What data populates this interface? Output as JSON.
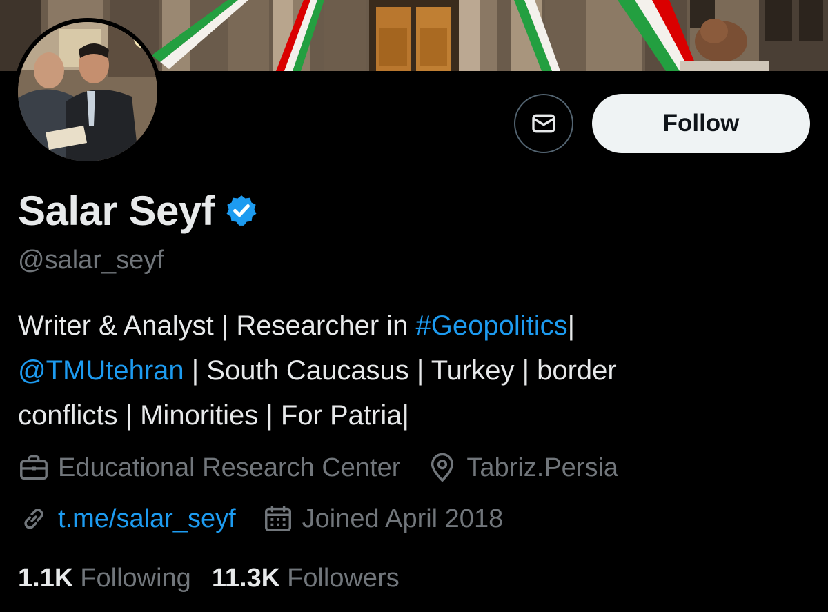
{
  "profile": {
    "display_name": "Salar Seyf",
    "verified": true,
    "handle": "@salar_seyf"
  },
  "actions": {
    "follow_label": "Follow",
    "message_icon": "envelope-icon"
  },
  "bio": {
    "line1": {
      "text": "Writer & Analyst | Researcher in ",
      "hashtag": "#Geopolitics",
      "tail": "|"
    },
    "line2": {
      "mention": "@TMUtehran",
      "text": " | South Caucasus | Turkey | border"
    },
    "line3": {
      "text": "conflicts | Minorities | For Patria|"
    }
  },
  "meta": {
    "professional_category": "Educational Research Center",
    "location": "Tabriz.Persia",
    "website": "t.me/salar_seyf",
    "joined": "Joined April 2018",
    "icons": {
      "category": "briefcase-icon",
      "location": "location-pin-icon",
      "website": "link-icon",
      "joined": "calendar-icon"
    }
  },
  "stats": {
    "following_count": "1.1K",
    "following_label": "Following",
    "followers_count": "11.3K",
    "followers_label": "Followers"
  },
  "colors": {
    "background": "#000000",
    "primary_text": "#e7e9ea",
    "secondary_text": "#71767b",
    "accent_link": "#1d9bf0",
    "follow_button_bg": "#eff3f4",
    "follow_button_text": "#0f1419",
    "border": "#536471"
  }
}
